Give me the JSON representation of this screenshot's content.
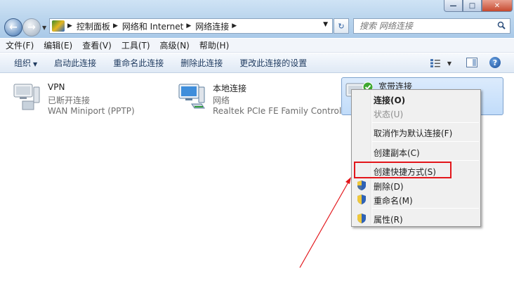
{
  "window": {
    "controls": {
      "minimize": "—",
      "maximize": "□",
      "close": "✕"
    }
  },
  "address": {
    "breadcrumbs": [
      "控制面板",
      "网络和 Internet",
      "网络连接"
    ],
    "search_placeholder": "搜索 网络连接"
  },
  "menubar": [
    "文件(F)",
    "编辑(E)",
    "查看(V)",
    "工具(T)",
    "高级(N)",
    "帮助(H)"
  ],
  "commandbar": {
    "organize": "组织",
    "items": [
      "启动此连接",
      "重命名此连接",
      "删除此连接",
      "更改此连接的设置"
    ],
    "help": "?"
  },
  "connections": [
    {
      "name": "VPN",
      "status": "已断开连接",
      "device": "WAN Miniport (PPTP)"
    },
    {
      "name": "本地连接",
      "status": "网络",
      "device": "Realtek PCIe FE Family Control..."
    },
    {
      "name": "宽带连接",
      "status": "",
      "device": ""
    }
  ],
  "context_menu": {
    "connect": "连接(O)",
    "status": "状态(U)",
    "cancel_default": "取消作为默认连接(F)",
    "create_copy": "创建副本(C)",
    "create_shortcut": "创建快捷方式(S)",
    "delete": "删除(D)",
    "rename": "重命名(M)",
    "properties": "属性(R)"
  },
  "colors": {
    "highlight_box": "#e3161b",
    "arrow": "#e3161b",
    "selection": "#c1dcfa"
  }
}
